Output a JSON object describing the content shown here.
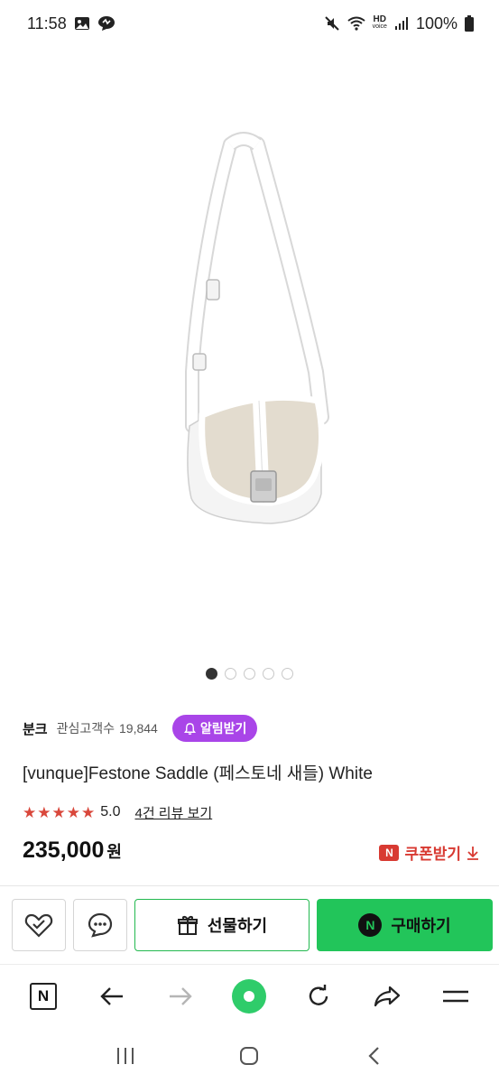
{
  "status_bar": {
    "time": "11:58",
    "battery": "100%",
    "icons": [
      "gallery-icon",
      "message-icon",
      "mute-icon",
      "wifi-icon",
      "hd-voice-icon",
      "signal-icon",
      "battery-icon"
    ],
    "hd_label": "HD",
    "voice_label": "voice"
  },
  "product": {
    "image": "white-saddle-bag",
    "carousel": {
      "count": 5,
      "active_index": 0
    },
    "seller_name": "분크",
    "fav_label": "관심고객수",
    "fav_count": "19,844",
    "alarm_label": "알림받기",
    "title": "[vunque]Festone Saddle (페스토네 새들) White",
    "rating": "5.0",
    "stars": 5,
    "review_link": "4건 리뷰 보기",
    "price": "235,000",
    "currency": "원",
    "coupon_badge": "N",
    "coupon_label": "쿠폰받기"
  },
  "actions": {
    "wishlist_icon": "heart-check-icon",
    "chat_icon": "chat-bubble-icon",
    "gift_label": "선물하기",
    "buy_badge": "N",
    "buy_label": "구매하기"
  },
  "browser_nav": {
    "icons": [
      "naver-home-icon",
      "back-arrow-icon",
      "forward-arrow-icon",
      "green-dot-icon",
      "refresh-icon",
      "share-icon",
      "menu-icon"
    ],
    "home_label": "N"
  },
  "system_nav": {
    "icons": [
      "recents-icon",
      "home-icon",
      "back-icon"
    ]
  },
  "colors": {
    "brand_green": "#22c55a",
    "alarm_purple": "#a945e8",
    "star_red": "#d9473b",
    "coupon_red": "#d83a32"
  }
}
